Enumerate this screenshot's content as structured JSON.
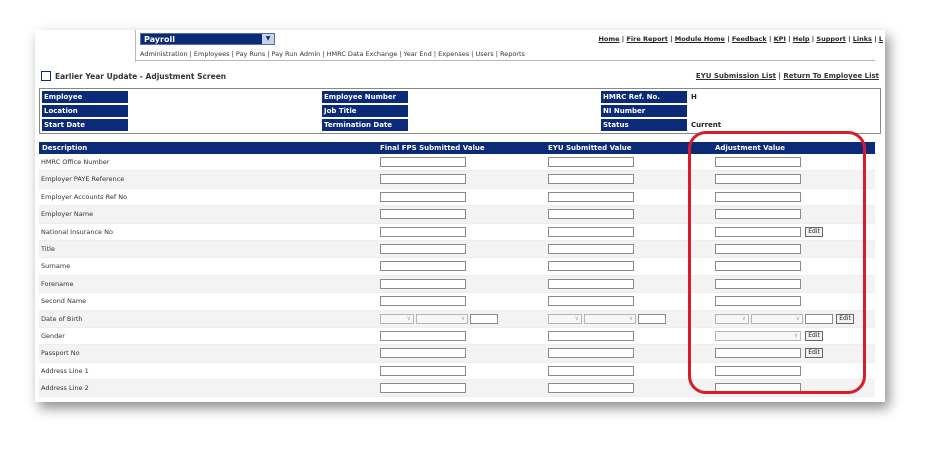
{
  "header": {
    "module": "Payroll",
    "top_links": [
      "Home",
      "Fire Report",
      "Module Home",
      "Feedback",
      "KPI",
      "Help",
      "Support",
      "Links",
      "L"
    ],
    "menu_items": [
      "Administration",
      "Employees",
      "Pay Runs",
      "Pay Run Admin",
      "HMRC Data Exchange",
      "Year End",
      "Expenses",
      "Users",
      "Reports"
    ]
  },
  "page": {
    "title": "Earlier Year Update - Adjustment Screen",
    "link_submission": "EYU Submission List",
    "link_separator": "|",
    "link_return": "Return To Employee List"
  },
  "info": {
    "employee": "Employee",
    "location": "Location",
    "start_date": "Start Date",
    "employee_number": "Employee Number",
    "job_title": "Job Title",
    "termination_date": "Termination Date",
    "hmrc_ref": "HMRC Ref. No.",
    "hmrc_ref_value": "H",
    "ni_number": "NI Number",
    "status": "Status",
    "status_value": "Current"
  },
  "grid": {
    "headers": [
      "Description",
      "Final FPS Submitted Value",
      "EYU Submitted Value",
      "Adjustment Value"
    ],
    "rows": [
      {
        "label": "HMRC Office Number"
      },
      {
        "label": "Employer PAYE Reference"
      },
      {
        "label": "Employer Accounts Ref No"
      },
      {
        "label": "Employer Name"
      },
      {
        "label": "National Insurance No",
        "edit": "Edit"
      },
      {
        "label": "Title"
      },
      {
        "label": "Surname"
      },
      {
        "label": "Forename"
      },
      {
        "label": "Second Name"
      },
      {
        "label": "Date of Birth",
        "edit": "Edit"
      },
      {
        "label": "Gender",
        "edit": "Edit"
      },
      {
        "label": "Passport No",
        "edit": "Edit"
      },
      {
        "label": "Address Line 1"
      },
      {
        "label": "Address Line 2"
      }
    ]
  },
  "colors": {
    "header_navy": "#0b2a78",
    "highlight_red": "#d81d2a"
  }
}
